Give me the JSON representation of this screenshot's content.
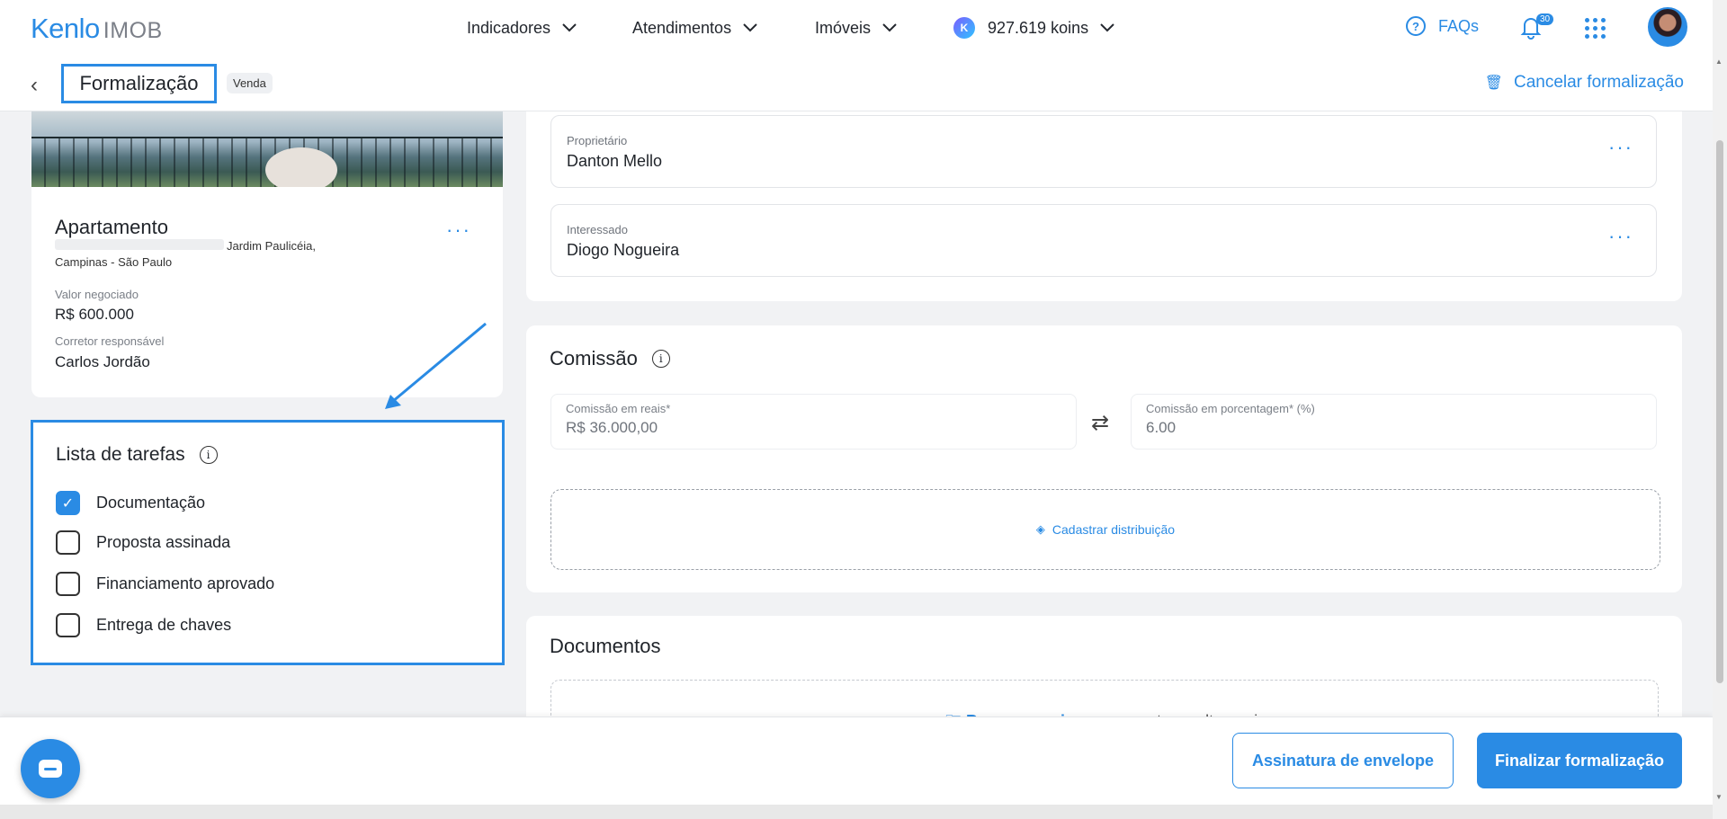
{
  "brand": {
    "logo_main": "Kenlo",
    "logo_sub": "IMOB"
  },
  "topnav": {
    "indicadores": "Indicadores",
    "atendimentos": "Atendimentos",
    "imoveis": "Imóveis",
    "koins": "927.619 koins",
    "koin_icon_letter": "K",
    "faqs": "FAQs",
    "notifications_count": "30"
  },
  "subheader": {
    "title": "Formalização",
    "tag": "Venda",
    "cancel_label": "Cancelar formalização"
  },
  "property": {
    "title": "Apartamento",
    "address_line1": "Jardim Paulicéia,",
    "address_line2": "Campinas - São Paulo",
    "valor_label": "Valor negociado",
    "valor": "R$ 600.000",
    "corretor_label": "Corretor responsável",
    "corretor": "Carlos Jordão"
  },
  "tasks": {
    "title": "Lista de tarefas",
    "items": [
      {
        "label": "Documentação",
        "checked": true
      },
      {
        "label": "Proposta assinada",
        "checked": false
      },
      {
        "label": "Financiamento aprovado",
        "checked": false
      },
      {
        "label": "Entrega de chaves",
        "checked": false
      }
    ]
  },
  "parties": {
    "owner_label": "Proprietário",
    "owner": "Danton Mello",
    "interested_label": "Interessado",
    "interested": "Diogo Nogueira"
  },
  "commission": {
    "title": "Comissão",
    "reais_label": "Comissão em reais*",
    "reais_value": "R$ 36.000,00",
    "percent_label": "Comissão em porcentagem* (%)",
    "percent_value": "6.00",
    "distribution_label": "Cadastrar distribuição"
  },
  "documents": {
    "title": "Documentos",
    "upload_link": "Buscar arquivos",
    "upload_text": "ou arraste e solte aqui"
  },
  "footer": {
    "envelope_button": "Assinatura de envelope",
    "finish_button": "Finalizar formalização"
  },
  "colors": {
    "accent": "#2a8be4",
    "background": "#f1f2f4"
  }
}
